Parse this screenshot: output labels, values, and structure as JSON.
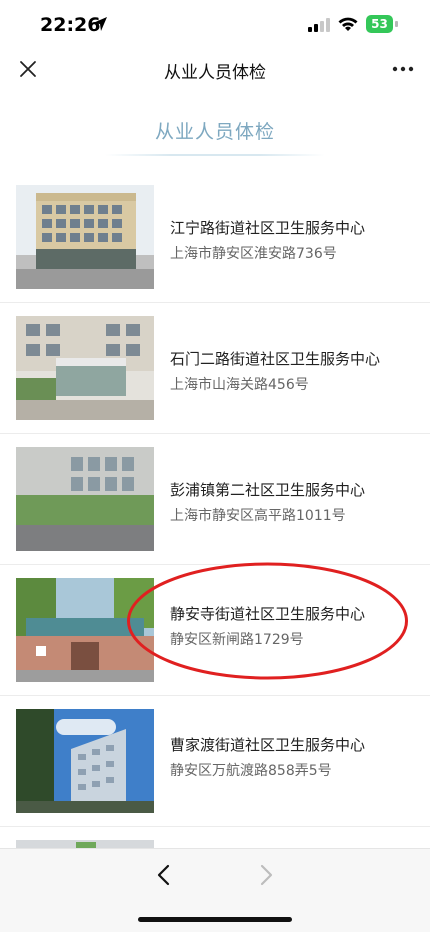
{
  "status_bar": {
    "time": "22:26",
    "battery": "53"
  },
  "header": {
    "title": "从业人员体检"
  },
  "section": {
    "title": "从业人员体检"
  },
  "centers": [
    {
      "name": "江宁路街道社区卫生服务中心",
      "address": "上海市静安区淮安路736号"
    },
    {
      "name": "石门二路街道社区卫生服务中心",
      "address": "上海市山海关路456号"
    },
    {
      "name": "彭浦镇第二社区卫生服务中心",
      "address": "上海市静安区高平路1011号"
    },
    {
      "name": "静安寺街道社区卫生服务中心",
      "address": "静安区新闸路1729号"
    },
    {
      "name": "曹家渡街道社区卫生服务中心",
      "address": "静安区万航渡路858弄5号"
    }
  ],
  "colors": {
    "accent": "#7ea8c0",
    "highlight_circle": "#e02020",
    "battery": "#34c759"
  },
  "icons": [
    "close-icon",
    "more-icon",
    "location-arrow-icon",
    "signal-icon",
    "wifi-icon",
    "battery-icon",
    "back-icon",
    "forward-icon"
  ]
}
